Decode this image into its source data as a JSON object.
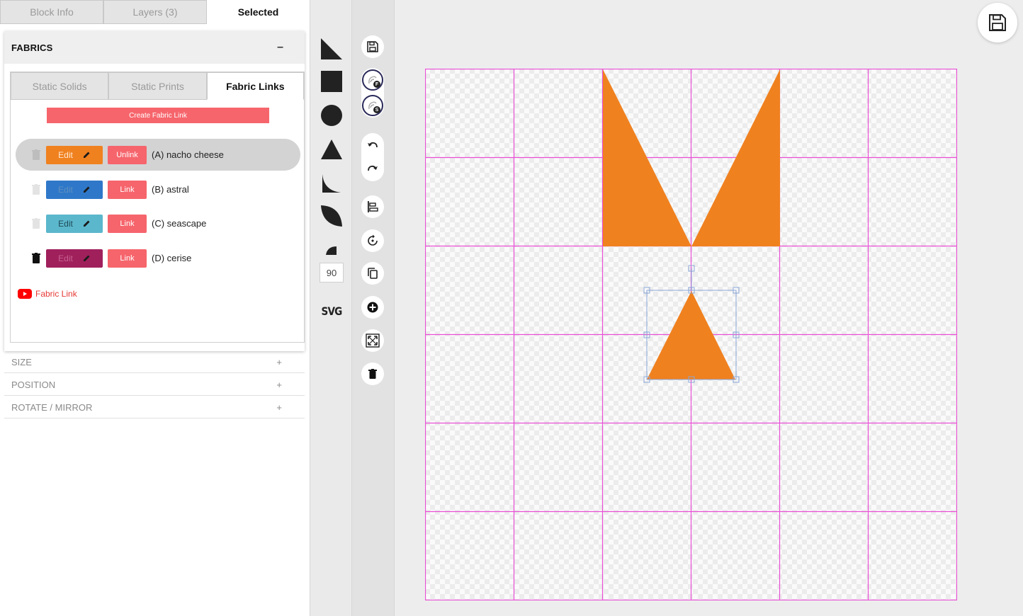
{
  "top_tabs": [
    {
      "label": "Block Info",
      "active": false
    },
    {
      "label": "Layers (3)",
      "active": false
    },
    {
      "label": "Selected",
      "active": true
    }
  ],
  "fabrics": {
    "title": "FABRICS",
    "collapse_symbol": "–",
    "sub_tabs": [
      {
        "label": "Static Solids",
        "active": false
      },
      {
        "label": "Static Prints",
        "active": false
      },
      {
        "label": "Fabric Links",
        "active": true
      }
    ],
    "create_label": "Create Fabric Link",
    "rows": [
      {
        "name": "(A) nacho cheese",
        "edit_label": "Edit",
        "link_label": "Unlink",
        "color": "#f0811f",
        "selected": true,
        "trash_active": false
      },
      {
        "name": "(B) astral",
        "edit_label": "Edit",
        "link_label": "Link",
        "color": "#2f78c9",
        "selected": false,
        "trash_active": false
      },
      {
        "name": "(C) seascape",
        "edit_label": "Edit",
        "link_label": "Link",
        "color": "#5bb7cc",
        "selected": false,
        "trash_active": false
      },
      {
        "name": "(D) cerise",
        "edit_label": "Edit",
        "link_label": "Link",
        "color": "#a0205c",
        "selected": false,
        "trash_active": true
      }
    ],
    "video_link_label": "Fabric Link"
  },
  "sections": [
    {
      "label": "SIZE",
      "symbol": "+"
    },
    {
      "label": "POSITION",
      "symbol": "+"
    },
    {
      "label": "ROTATE / MIRROR",
      "symbol": "+"
    }
  ],
  "tools": {
    "angle_value": "90",
    "svg_label": "SVG"
  },
  "action_badges": {
    "fabric": "F",
    "solid": "S"
  },
  "canvas": {
    "grid_color": "#e94fd6",
    "shape_color": "#f0811f",
    "selection_color": "#8aa7d8"
  }
}
